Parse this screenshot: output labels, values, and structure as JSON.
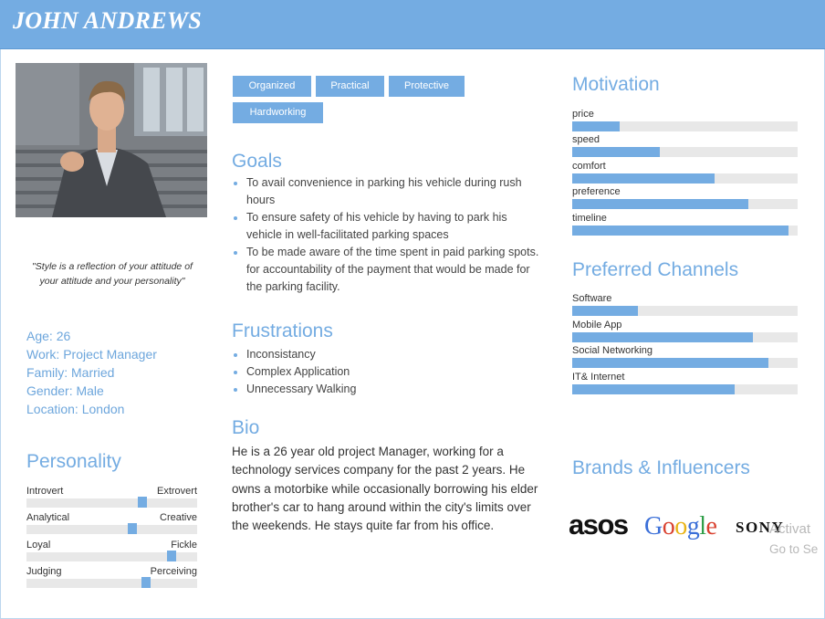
{
  "persona": {
    "name": "JOHN ANDREWS",
    "quote": "\"Style is a reflection of your attitude of your attitude and your personality\"",
    "info": [
      "Age: 26",
      "Work: Project Manager",
      "Family: Married",
      "Gender: Male",
      "Location: London"
    ]
  },
  "personality": {
    "title": "Personality",
    "traits": [
      {
        "left": "Introvert",
        "right": "Extrovert",
        "value": 0.68
      },
      {
        "left": "Analytical",
        "right": "Creative",
        "value": 0.62
      },
      {
        "left": "Loyal",
        "right": "Fickle",
        "value": 0.85
      },
      {
        "left": "Judging",
        "right": "Perceiving",
        "value": 0.7
      }
    ]
  },
  "tags": [
    "Organized",
    "Practical",
    "Protective",
    "Hardworking"
  ],
  "goals": {
    "title": "Goals",
    "items": [
      "To avail convenience in parking his vehicle during rush hours",
      "To ensure safety of his vehicle by having to park his vehicle in well-facilitated parking spaces",
      "To be made aware of the time spent in paid parking spots. for accountability of the payment that would be made for the parking facility."
    ]
  },
  "frustrations": {
    "title": "Frustrations",
    "items": [
      "Inconsistancy",
      "Complex Application",
      "Unnecessary Walking"
    ]
  },
  "bio": {
    "title": "Bio",
    "text": "He is a 26 year old project Manager, working for a technology services company for the past 2 years. He owns a motorbike while occasionally borrowing his elder brother's car to hang around within the city's limits over the weekends. He stays quite far from his office."
  },
  "motivation": {
    "title": "Motivation",
    "items": [
      {
        "label": "price",
        "value": 0.21
      },
      {
        "label": "speed",
        "value": 0.39
      },
      {
        "label": "comfort",
        "value": 0.63
      },
      {
        "label": "preference",
        "value": 0.78
      },
      {
        "label": "timeline",
        "value": 0.96
      }
    ]
  },
  "channels": {
    "title": "Preferred Channels",
    "items": [
      {
        "label": "Software",
        "value": 0.29
      },
      {
        "label": "Mobile App",
        "value": 0.8
      },
      {
        "label": "Social Networking",
        "value": 0.87
      },
      {
        "label": "IT& Internet",
        "value": 0.72
      }
    ]
  },
  "brands": {
    "title": "Brands & Influencers",
    "logos": [
      "asos",
      "Google",
      "SONY"
    ]
  },
  "watermark": {
    "line1": "Activat",
    "line2": "Go to Se"
  },
  "colors": {
    "accent": "#74ace2",
    "track": "#e8e8e8"
  }
}
